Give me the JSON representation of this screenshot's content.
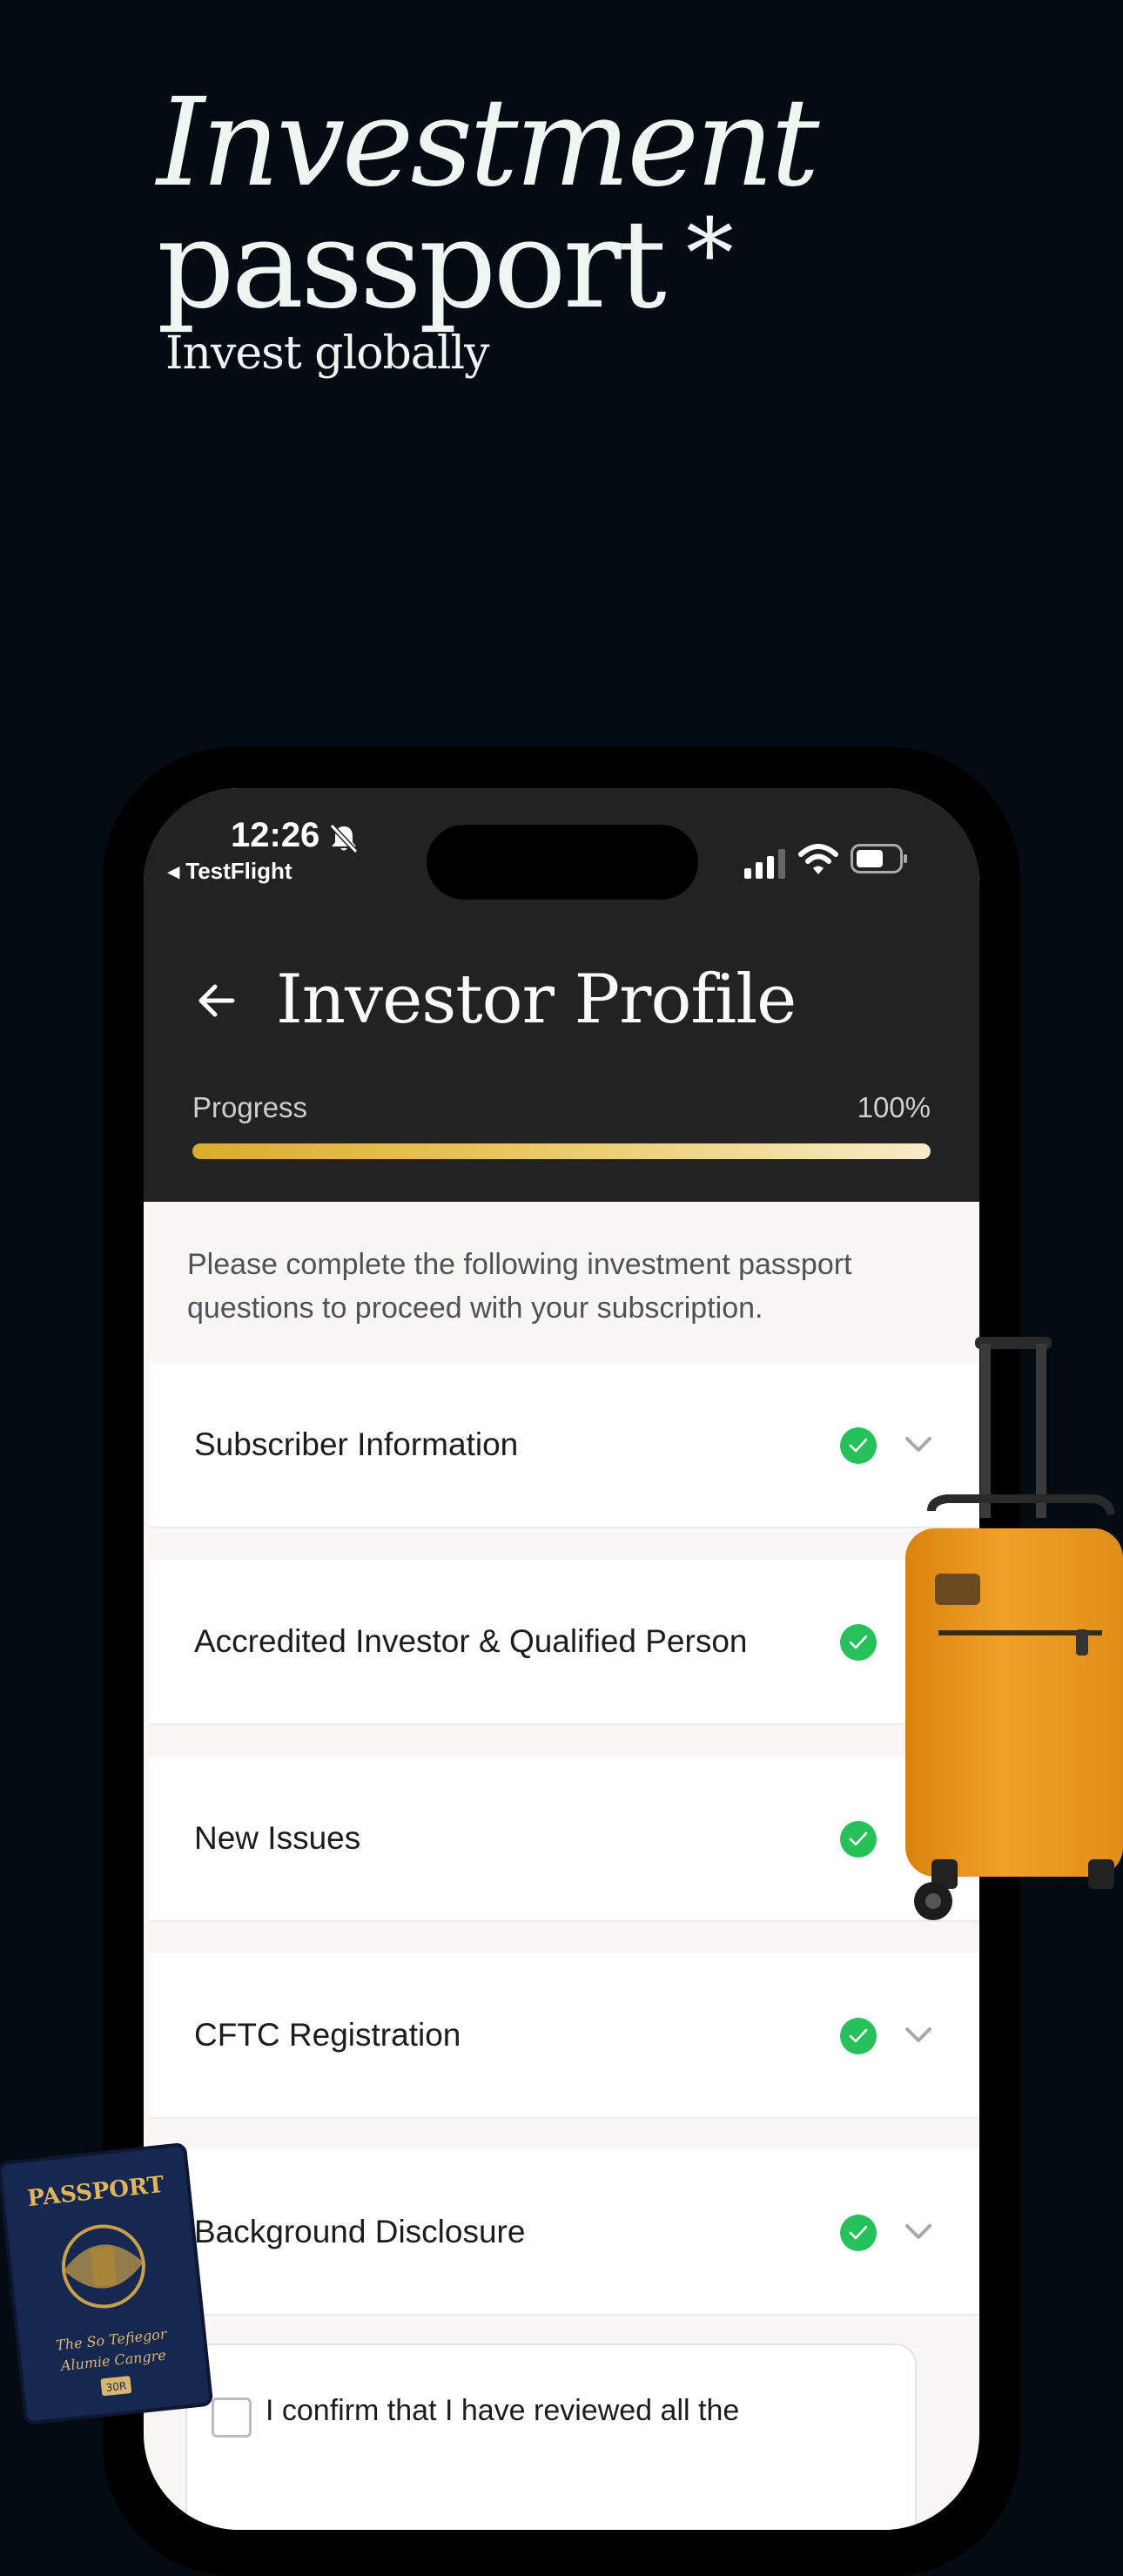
{
  "hero": {
    "line1": "Investment",
    "line2": "passport",
    "asterisk": "*",
    "subtitle": "Invest globally"
  },
  "status_bar": {
    "time": "12:26",
    "back_app": "◂ TestFlight"
  },
  "header": {
    "title": "Investor Profile",
    "progress_label": "Progress",
    "progress_value": "100%",
    "progress_fraction": 1.0
  },
  "intro_text": "Please complete the following investment passport questions to proceed with your subscription.",
  "sections": [
    {
      "label": "Subscriber Information",
      "complete": true
    },
    {
      "label": "Accredited Investor & Qualified Person",
      "complete": true
    },
    {
      "label": "New Issues",
      "complete": true
    },
    {
      "label": "CFTC Registration",
      "complete": true
    },
    {
      "label": "Background Disclosure",
      "complete": true
    }
  ],
  "confirm": {
    "text": "I confirm that I have reviewed all the"
  },
  "passport_image": {
    "title": "PASSPORT",
    "line1": "The So Tefiegor",
    "line2": "Alumie Cangre",
    "badge": "30R"
  },
  "colors": {
    "background": "#040b12",
    "header": "#222222",
    "check": "#27c15c",
    "progress_start": "#d9ad2a",
    "progress_end": "#f8ecc7"
  }
}
